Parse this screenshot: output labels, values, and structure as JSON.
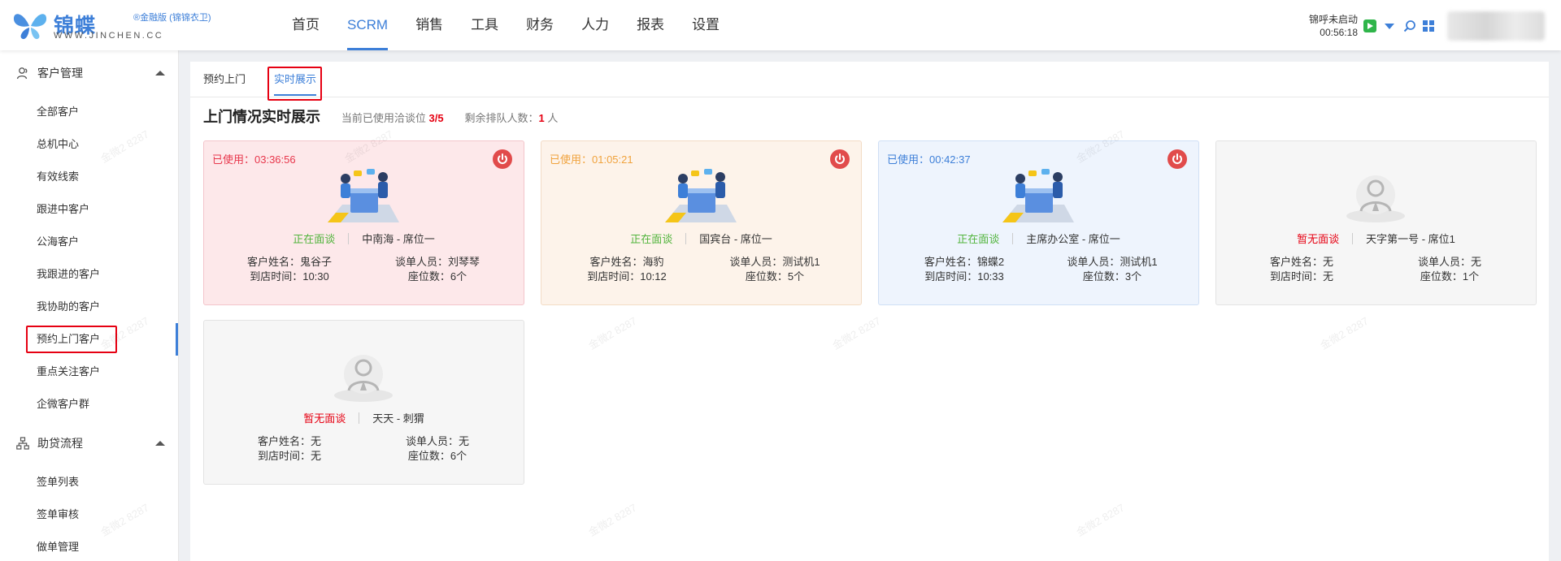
{
  "header": {
    "logo_name": "锦蝶",
    "logo_sup": "®金融版 (锦锦衣卫)",
    "logo_domain": "WWW.JINCHEN.CC",
    "nav": [
      "首页",
      "SCRM",
      "销售",
      "工具",
      "财务",
      "人力",
      "报表",
      "设置"
    ],
    "active_nav": "SCRM",
    "call_status": "锦呼未启动",
    "call_time": "00:56:18"
  },
  "sidebar": {
    "groups": [
      {
        "label": "客户管理",
        "items": [
          "全部客户",
          "总机中心",
          "有效线索",
          "跟进中客户",
          "公海客户",
          "我跟进的客户",
          "我协助的客户",
          "预约上门客户",
          "重点关注客户",
          "企微客户群"
        ]
      },
      {
        "label": "助贷流程",
        "items": [
          "签单列表",
          "签单审核",
          "做单管理"
        ]
      }
    ],
    "active_item": "预约上门客户"
  },
  "tabs": [
    "预约上门",
    "实时展示"
  ],
  "active_tab": "实时展示",
  "title": "上门情况实时展示",
  "meta": {
    "seat_label": "当前已使用洽谈位",
    "seat_value": "3/5",
    "queue_label": "剩余排队人数：",
    "queue_value": "1",
    "queue_unit": "人"
  },
  "cards": [
    {
      "time": "已使用：03:36:56",
      "status": "正在面谈",
      "location": "中南海 - 席位一",
      "customer": "客户姓名：鬼谷子",
      "arrive": "到店时间：10:30",
      "staff": "谈单人员：刘琴琴",
      "seats": "座位数：6个",
      "color": "red"
    },
    {
      "time": "已使用：01:05:21",
      "status": "正在面谈",
      "location": "国宾台 - 席位一",
      "customer": "客户姓名：海豹",
      "arrive": "到店时间：10:12",
      "staff": "谈单人员：测试机1",
      "seats": "座位数：5个",
      "color": "orange"
    },
    {
      "time": "已使用：00:42:37",
      "status": "正在面谈",
      "location": "主席办公室 - 席位一",
      "customer": "客户姓名：锦蝶2",
      "arrive": "到店时间：10:33",
      "staff": "谈单人员：测试机1",
      "seats": "座位数：3个",
      "color": "blue"
    },
    {
      "time": "",
      "status": "暂无面谈",
      "location": "天字第一号 - 席位1",
      "customer": "客户姓名：无",
      "arrive": "到店时间：无",
      "staff": "谈单人员：无",
      "seats": "座位数：1个",
      "color": "gray"
    },
    {
      "time": "",
      "status": "暂无面谈",
      "location": "天天 - 刺猬",
      "customer": "客户姓名：无",
      "arrive": "到店时间：无",
      "staff": "谈单人员：无",
      "seats": "座位数：6个",
      "color": "gray"
    }
  ],
  "watermark": "金微2 8287",
  "colors": {
    "accent": "#3d7fd8",
    "active_status": "#52b43d",
    "idle_status": "#e60012",
    "red_time": "#e8374c",
    "orange_time": "#f0a23c",
    "blue_time": "#3d7fd8"
  }
}
